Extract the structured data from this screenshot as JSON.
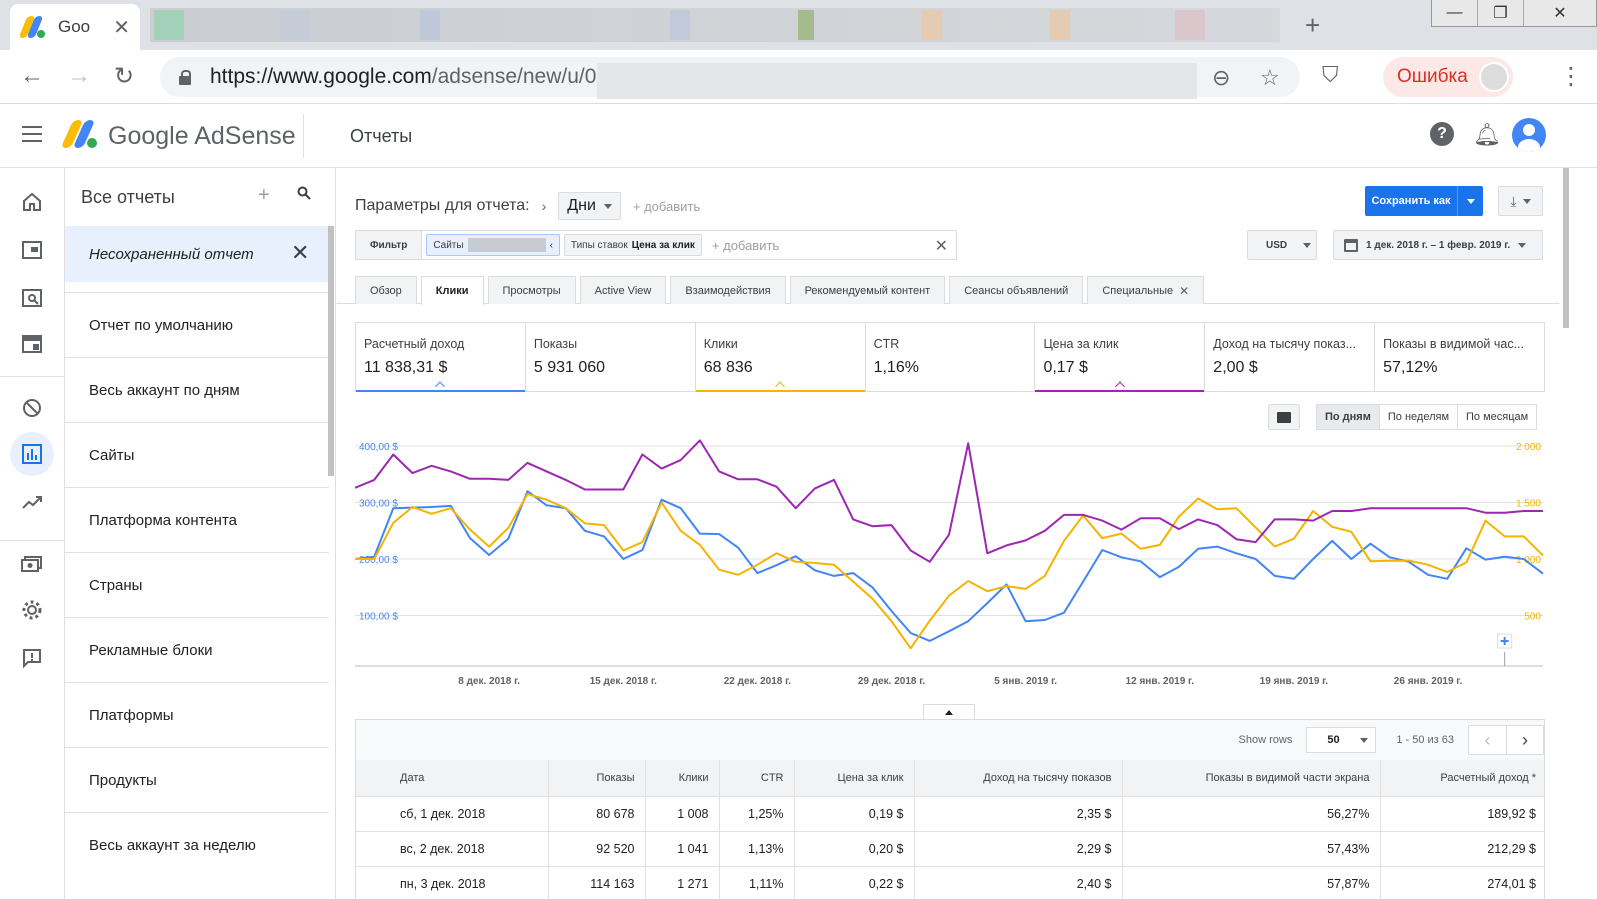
{
  "browser": {
    "tab_title": "Goo",
    "url_host": "https://www.google.com",
    "url_path": "/adsense/new/u/0",
    "error_label": "Ошибка"
  },
  "header": {
    "brand_google": "Google",
    "brand_product": "AdSense",
    "title": "Отчеты"
  },
  "reports_panel": {
    "title": "Все отчеты",
    "unsaved": "Несохраненный отчет",
    "items": [
      "Отчет по умолчанию",
      "Весь аккаунт по дням",
      "Сайты",
      "Платформа контента",
      "Страны",
      "Рекламные блоки",
      "Платформы",
      "Продукты",
      "Весь аккаунт за неделю"
    ]
  },
  "params": {
    "label": "Параметры для отчета:",
    "dimension": "Дни",
    "add": "+ добавить",
    "save": "Сохранить как"
  },
  "filter": {
    "label": "Фильтр",
    "sites_chip": "Сайты",
    "bid_chip_prefix": "Типы ставок",
    "bid_chip_value": "Цена за клик",
    "add": "+ добавить"
  },
  "currency": "USD",
  "date_range": "1 дек. 2018 г. – 1 февр. 2019 г.",
  "tabs": [
    "Обзор",
    "Клики",
    "Просмотры",
    "Active View",
    "Взаимодействия",
    "Рекомендуемый контент",
    "Сеансы объявлений",
    "Специальные"
  ],
  "kpis": [
    {
      "label": "Расчетный доход",
      "value": "11 838,31 $"
    },
    {
      "label": "Показы",
      "value": "5 931 060"
    },
    {
      "label": "Клики",
      "value": "68 836"
    },
    {
      "label": "CTR",
      "value": "1,16%"
    },
    {
      "label": "Цена за клик",
      "value": "0,17 $"
    },
    {
      "label": "Доход на тысячу показ...",
      "value": "2,00 $"
    },
    {
      "label": "Показы в видимой час...",
      "value": "57,12%"
    }
  ],
  "period": [
    "По дням",
    "По неделям",
    "По месяцам"
  ],
  "colors": {
    "blue": "#4285f4",
    "orange": "#f4b400",
    "purple": "#9c27b0"
  },
  "chart_data": {
    "type": "line",
    "x_labels": [
      "8 дек. 2018 г.",
      "15 дек. 2018 г.",
      "22 дек. 2018 г.",
      "29 дек. 2018 г.",
      "5 янв. 2019 г.",
      "12 янв. 2019 г.",
      "19 янв. 2019 г.",
      "26 янв. 2019 г."
    ],
    "left_axis": {
      "ticks": [
        "400,00 $",
        "300,00 $",
        "200,00 $",
        "100,00 $"
      ],
      "values": [
        400,
        300,
        200,
        100
      ],
      "range": [
        0,
        400
      ]
    },
    "right_axis": {
      "ticks": [
        "2 000",
        "1 500",
        "1 000",
        "500"
      ],
      "values": [
        2000,
        1500,
        1000,
        500
      ],
      "range": [
        0,
        2000
      ]
    },
    "series": [
      {
        "color": "#4285f4",
        "axis": "left",
        "values": [
          200,
          204,
          290,
          291,
          292,
          294,
          237,
          207,
          236,
          320,
          295,
          290,
          250,
          240,
          200,
          216,
          305,
          290,
          245,
          244,
          220,
          175,
          189,
          205,
          180,
          170,
          175,
          150,
          108,
          69,
          55,
          72,
          90,
          122,
          155,
          90,
          92,
          105,
          160,
          216,
          203,
          196,
          168,
          186,
          218,
          222,
          210,
          200,
          170,
          165,
          200,
          232,
          200,
          227,
          203,
          195,
          172,
          165,
          219,
          199,
          204,
          200,
          174
        ]
      },
      {
        "color": "#f4b400",
        "axis": "left",
        "values": [
          200,
          200,
          264,
          292,
          280,
          290,
          252,
          222,
          255,
          315,
          305,
          290,
          263,
          260,
          215,
          230,
          300,
          250,
          225,
          181,
          172,
          190,
          210,
          195,
          193,
          190,
          160,
          130,
          90,
          42,
          91,
          135,
          161,
          143,
          152,
          147,
          170,
          232,
          277,
          237,
          245,
          218,
          225,
          275,
          307,
          288,
          290,
          256,
          222,
          236,
          285,
          257,
          248,
          196,
          197,
          197,
          190,
          177,
          194,
          268,
          240,
          240,
          206
        ]
      },
      {
        "color": "#9c27b0",
        "axis": "left",
        "values": [
          326,
          340,
          385,
          352,
          365,
          355,
          342,
          342,
          340,
          370,
          355,
          340,
          323,
          323,
          323,
          385,
          360,
          375,
          410,
          355,
          341,
          341,
          328,
          290,
          325,
          340,
          270,
          258,
          260,
          215,
          195,
          243,
          405,
          210,
          224,
          233,
          250,
          278,
          278,
          268,
          252,
          272,
          272,
          253,
          270,
          260,
          235,
          230,
          270,
          270,
          268,
          285,
          285,
          290,
          290,
          290,
          290,
          290,
          290,
          282,
          282,
          285,
          285
        ]
      }
    ]
  },
  "table": {
    "show_rows_label": "Show rows",
    "rows": "50",
    "range": "1 - 50 из 63",
    "columns": [
      "Дата",
      "Показы",
      "Клики",
      "CTR",
      "Цена за клик",
      "Доход на тысячу показов",
      "Показы в видимой части экрана",
      "Расчетный доход *"
    ],
    "data": [
      [
        "сб, 1 дек. 2018",
        "80 678",
        "1 008",
        "1,25%",
        "0,19 $",
        "2,35 $",
        "56,27%",
        "189,92 $"
      ],
      [
        "вс, 2 дек. 2018",
        "92 520",
        "1 041",
        "1,13%",
        "0,20 $",
        "2,29 $",
        "57,43%",
        "212,29 $"
      ],
      [
        "пн, 3 дек. 2018",
        "114 163",
        "1 271",
        "1,11%",
        "0,22 $",
        "2,40 $",
        "57,87%",
        "274,01 $"
      ]
    ]
  }
}
